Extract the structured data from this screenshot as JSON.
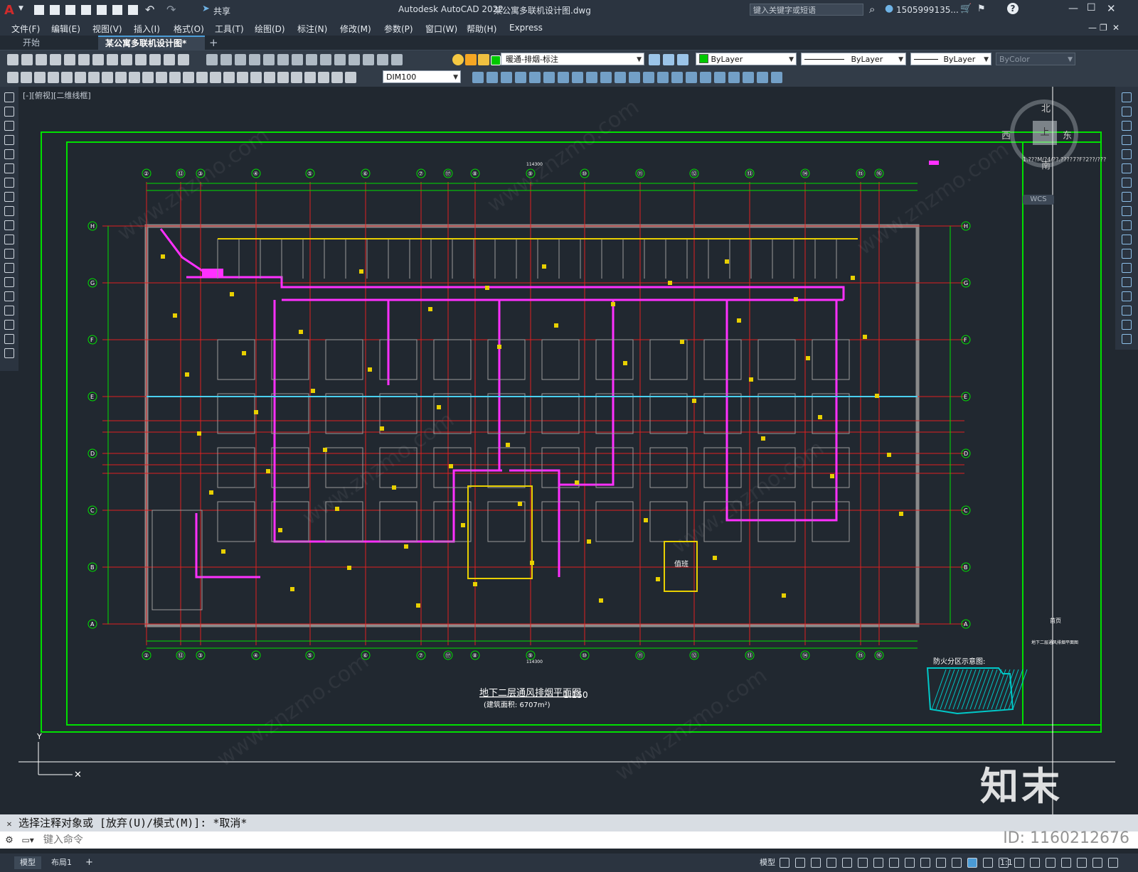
{
  "app": {
    "title": "Autodesk AutoCAD 2022",
    "document": "某公寓多联机设计图.dwg",
    "share_label": "共享",
    "search_placeholder": "键入关键字或短语",
    "user": "1505999135...",
    "colors": {
      "accent": "#4a9bd6",
      "logo": "#d02b2b"
    }
  },
  "menus": [
    "文件(F)",
    "编辑(E)",
    "视图(V)",
    "插入(I)",
    "格式(O)",
    "工具(T)",
    "绘图(D)",
    "标注(N)",
    "修改(M)",
    "参数(P)",
    "窗口(W)",
    "帮助(H)",
    "Express"
  ],
  "tabs": {
    "start": "开始",
    "active": "某公寓多联机设计图*"
  },
  "toolbar": {
    "layer": "暖通-排烟-标注",
    "color": "ByLayer",
    "linetype": "ByLayer",
    "lineweight": "ByLayer",
    "plotstyle": "ByColor",
    "dimstyle": "DIM100"
  },
  "viewport": {
    "label": "[-][俯视][二维线框]",
    "viewcube": {
      "north": "北",
      "south": "南",
      "east": "东",
      "west": "西",
      "top": "上",
      "wcs": "WCS",
      "ucs_label": "1.???M/?4/??.????7?F?2??/???"
    }
  },
  "drawing": {
    "title": "地下二层通风排烟平面图",
    "scale": "1:150",
    "area": "(建筑面积: 6707m²)",
    "legend_title": "防火分区示意图:",
    "col_labels": [
      "②",
      "⑫",
      "③",
      "④",
      "⑤",
      "⑥",
      "⑦",
      "⑰",
      "⑧",
      "⑨",
      "⑩",
      "⑪",
      "⑫",
      "⑬",
      "⑭",
      "⑮",
      "⑯"
    ],
    "row_labels": [
      "H",
      "G",
      "F",
      "E",
      "D",
      "C",
      "B",
      "A"
    ],
    "total_dim": "114300",
    "room_label": "值班",
    "title_block": [
      "首页",
      "地下二层通风排烟平面图"
    ]
  },
  "watermark": {
    "site": "www.znzmo.com",
    "brand": "知末",
    "id": "ID: 1160212676"
  },
  "command": {
    "history": "选择注释对象或 [放弃(U)/模式(M)]: *取消*",
    "placeholder": "键入命令"
  },
  "status": {
    "model_tab": "模型",
    "layout_tab": "布局1",
    "add": "+",
    "model": "模型",
    "scale": "1:1"
  }
}
